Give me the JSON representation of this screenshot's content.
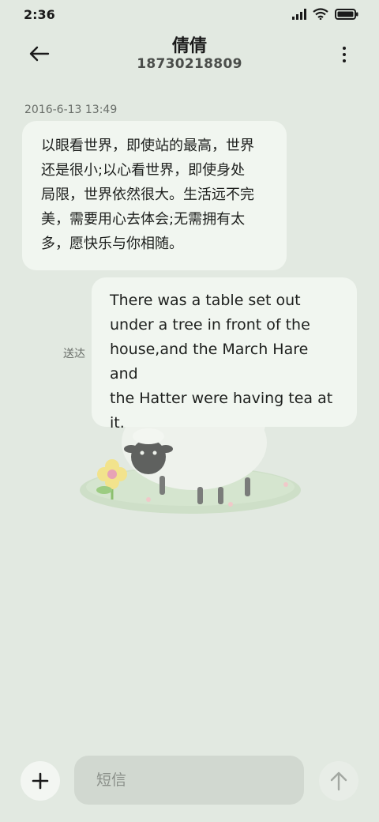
{
  "status_bar": {
    "time": "2:36",
    "icons": [
      "signal-icon",
      "wifi-icon",
      "battery-icon"
    ]
  },
  "header": {
    "contact_name": "倩倩",
    "contact_number": "18730218809",
    "back_icon": "back-arrow-icon",
    "more_icon": "more-vertical-icon"
  },
  "conversation": {
    "timestamp": "2016-6-13 13:49",
    "incoming_message": {
      "lines": [
        "以眼看世界，即使站的最高，世界",
        "还是很小;以心看世界，即使身处",
        "局限，世界依然很大。生活远不完",
        "美，需要用心去体会;无需拥有太",
        "多，愿快乐与你相随。"
      ]
    },
    "outgoing_message": {
      "lines": [
        "There was a table set out",
        "under a tree in front of the",
        "house,and the March Hare and",
        "the Hatter were having tea at",
        "it."
      ],
      "status": "送达"
    }
  },
  "compose": {
    "placeholder": "短信",
    "value": "",
    "attach_icon": "plus-icon",
    "send_icon": "send-arrow-up-icon"
  },
  "colors": {
    "background": "#e2e9e1",
    "bubble": "#f1f6f0",
    "input": "#d1d8d0"
  }
}
